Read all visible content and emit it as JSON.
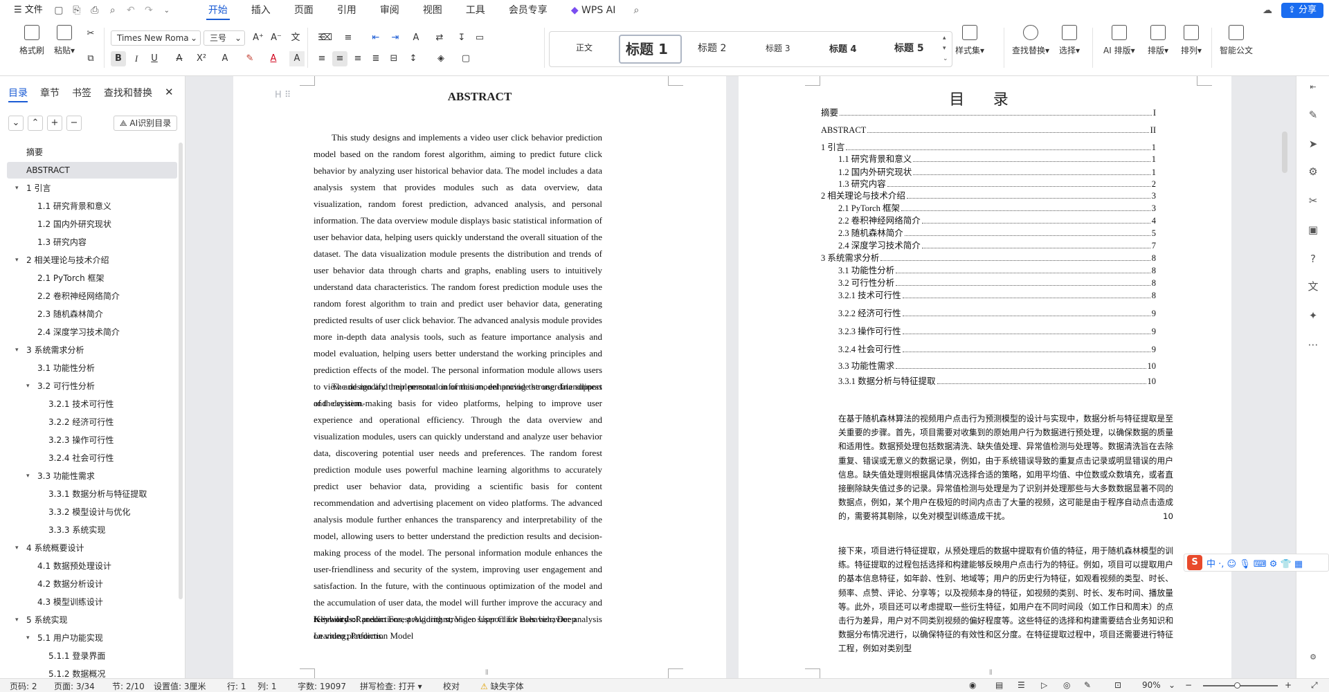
{
  "menubar": {
    "file": "文件",
    "tabs": [
      "开始",
      "插入",
      "页面",
      "引用",
      "审阅",
      "视图",
      "工具",
      "会员专享"
    ],
    "wps_ai": "WPS AI",
    "share": "分享"
  },
  "ribbon": {
    "format_painter": "格式刷",
    "paste": "粘贴",
    "font_name": "Times New Roma",
    "font_size": "三号",
    "styles": [
      "正文",
      "标题 1",
      "标题 2",
      "标题 3",
      "标题 4",
      "标题 5"
    ],
    "style_set": "样式集",
    "find_replace": "查找替换",
    "select": "选择",
    "ai_layout": "AI 排版",
    "layout": "排版",
    "arrange": "排列",
    "smart_doc": "智能公文"
  },
  "sidebar": {
    "tabs": [
      "目录",
      "章节",
      "书签",
      "查找和替换"
    ],
    "ai_toc": "AI识别目录",
    "items": [
      {
        "label": "摘要",
        "level": 1,
        "arrow": false
      },
      {
        "label": "ABSTRACT",
        "level": 1,
        "arrow": false,
        "selected": true
      },
      {
        "label": "1 引言",
        "level": 1,
        "arrow": true
      },
      {
        "label": "1.1 研究背景和意义",
        "level": 2,
        "arrow": false
      },
      {
        "label": "1.2 国内外研究现状",
        "level": 2,
        "arrow": false
      },
      {
        "label": "1.3 研究内容",
        "level": 2,
        "arrow": false
      },
      {
        "label": "2 相关理论与技术介绍",
        "level": 1,
        "arrow": true
      },
      {
        "label": "2.1 PyTorch 框架",
        "level": 2,
        "arrow": false
      },
      {
        "label": "2.2 卷积神经网络简介",
        "level": 2,
        "arrow": false
      },
      {
        "label": "2.3 随机森林简介",
        "level": 2,
        "arrow": false
      },
      {
        "label": "2.4 深度学习技术简介",
        "level": 2,
        "arrow": false
      },
      {
        "label": "3 系统需求分析",
        "level": 1,
        "arrow": true
      },
      {
        "label": "3.1 功能性分析",
        "level": 2,
        "arrow": false
      },
      {
        "label": "3.2 可行性分析",
        "level": 2,
        "arrow": true
      },
      {
        "label": "3.2.1 技术可行性",
        "level": 3,
        "arrow": false
      },
      {
        "label": "3.2.2 经济可行性",
        "level": 3,
        "arrow": false
      },
      {
        "label": "3.2.3 操作可行性",
        "level": 3,
        "arrow": false
      },
      {
        "label": "3.2.4 社会可行性",
        "level": 3,
        "arrow": false
      },
      {
        "label": "3.3 功能性需求",
        "level": 2,
        "arrow": true
      },
      {
        "label": "3.3.1 数据分析与特征提取",
        "level": 3,
        "arrow": false
      },
      {
        "label": "3.3.2 模型设计与优化",
        "level": 3,
        "arrow": false
      },
      {
        "label": "3.3.3 系统实现",
        "level": 3,
        "arrow": false
      },
      {
        "label": "4 系统概要设计",
        "level": 1,
        "arrow": true
      },
      {
        "label": "4.1 数据预处理设计",
        "level": 2,
        "arrow": false
      },
      {
        "label": "4.2 数据分析设计",
        "level": 2,
        "arrow": false
      },
      {
        "label": "4.3 模型训练设计",
        "level": 2,
        "arrow": false
      },
      {
        "label": "5 系统实现",
        "level": 1,
        "arrow": true
      },
      {
        "label": "5.1 用户功能实现",
        "level": 2,
        "arrow": true
      },
      {
        "label": "5.1.1 登录界面",
        "level": 3,
        "arrow": false
      },
      {
        "label": "5.1.2 数据概况",
        "level": 3,
        "arrow": false
      }
    ]
  },
  "page1": {
    "title": "ABSTRACT",
    "para1": "This study designs and implements a video user click behavior prediction model based on the random forest algorithm, aiming to predict future click behavior by analyzing user historical behavior data. The model includes a data analysis system that provides modules such as data overview, data visualization, random forest prediction, advanced analysis, and personal information. The data overview module displays basic statistical information of user behavior data, helping users quickly understand the overall situation of the dataset. The data visualization module presents the distribution and trends of user behavior data through charts and graphs, enabling users to intuitively understand data characteristics. The random forest prediction module uses the random forest algorithm to train and predict user behavior data, generating predicted results of user click behavior. The advanced analysis module provides more in-depth data analysis tools, such as feature importance analysis and model evaluation, helping users better understand the working principles and prediction effects of the model. The personal information module allows users to view and modify their personal information, enhancing the user-friendliness of the system.",
    "para2": "The design and implementation of this model provide strong data support and decision-making basis for video platforms, helping to improve user experience and operational efficiency. Through the data overview and visualization modules, users can quickly understand and analyze user behavior data, discovering potential user needs and preferences. The random forest prediction module uses powerful machine learning algorithms to accurately predict user behavior data, providing a scientific basis for content recommendation and advertising placement on video platforms. The advanced analysis module further enhances the transparency and interpretability of the model, allowing users to better understand the prediction results and decision-making process of the model. The personal information module enhances the user-friendliness and security of the system, improving user engagement and satisfaction. In the future, with the continuous optimization of the model and the accumulation of user data, the model will further improve the accuracy and reliability of predictions, providing stronger support for user behavior analysis on video platforms.",
    "keywords_label": "Keywords:",
    "keywords": "Random Forest Algorithm; Video User Click Behavior; Deep Learning; Prediction Model"
  },
  "page2": {
    "title": "目 录",
    "entries": [
      {
        "text": "摘要",
        "page": "I",
        "indent": 0
      },
      {
        "text": "ABSTRACT",
        "page": "II",
        "indent": 0
      },
      {
        "text": "1 引言",
        "page": "1",
        "indent": 0
      },
      {
        "text": "1.1 研究背景和意义",
        "page": "1",
        "indent": 1
      },
      {
        "text": "1.2 国内外研究现状",
        "page": "1",
        "indent": 1
      },
      {
        "text": "1.3 研究内容",
        "page": "2",
        "indent": 1
      },
      {
        "text": "2 相关理论与技术介绍",
        "page": "3",
        "indent": 0
      },
      {
        "text": "2.1 PyTorch 框架",
        "page": "3",
        "indent": 1
      },
      {
        "text": "2.2 卷积神经网络简介",
        "page": "4",
        "indent": 1
      },
      {
        "text": "2.3 随机森林简介",
        "page": "5",
        "indent": 1
      },
      {
        "text": "2.4 深度学习技术简介",
        "page": "7",
        "indent": 1
      },
      {
        "text": "3 系统需求分析",
        "page": "8",
        "indent": 0
      },
      {
        "text": "3.1 功能性分析",
        "page": "8",
        "indent": 1
      },
      {
        "text": "3.2 可行性分析",
        "page": "8",
        "indent": 1
      },
      {
        "text": "3.2.1 技术可行性",
        "page": "8",
        "indent": 1
      },
      {
        "text": "3.2.2 经济可行性",
        "page": "9",
        "indent": 1
      },
      {
        "text": "3.2.3 操作可行性",
        "page": "9",
        "indent": 1
      },
      {
        "text": "3.2.4 社会可行性",
        "page": "9",
        "indent": 1
      },
      {
        "text": "3.3 功能性需求",
        "page": "10",
        "indent": 1
      },
      {
        "text": "3.3.1 数据分析与特征提取",
        "page": "10",
        "indent": 1
      }
    ],
    "para1": "在基于随机森林算法的视频用户点击行为预测模型的设计与实现中，数据分析与特征提取是至关重要的步骤。首先，项目需要对收集到的原始用户行为数据进行预处理，以确保数据的质量和适用性。数据预处理包括数据清洗、缺失值处理、异常值检测与处理等。数据清洗旨在去除重复、错误或无意义的数据记录，例如，由于系统错误导致的重复点击记录或明显错误的用户信息。缺失值处理则根据具体情况选择合适的策略，如用平均值、中位数或众数填充，或者直接删除缺失值过多的记录。异常值检测与处理是为了识别并处理那些与大多数数据显著不同的数据点，例如，某个用户在极短的时间内点击了大量的视频，这可能是由于程序自动点击造成的，需要将其剔除，以免对模型训练造成干扰。",
    "para1_page": "10",
    "para2": "接下来，项目进行特征提取，从预处理后的数据中提取有价值的特征，用于随机森林模型的训练。特征提取的过程包括选择和构建能够反映用户点击行为的特征。例如，项目可以提取用户的基本信息特征，如年龄、性别、地域等；用户的历史行为特征，如观看视频的类型、时长、频率、点赞、评论、分享等；以及视频本身的特征，如视频的类别、时长、发布时间、播放量等。此外，项目还可以考虑提取一些衍生特征，如用户在不同时间段（如工作日和周末）的点击行为差异，用户对不同类别视频的偏好程度等。这些特征的选择和构建需要结合业务知识和数据分布情况进行，以确保特征的有效性和区分度。在特征提取过程中，项目还需要进行特征工程，例如对类别型"
  },
  "statusbar": {
    "page_no": "页码: 2",
    "pages": "页面: 3/34",
    "section": "节: 2/10",
    "setting": "设置值: 3厘米",
    "row": "行: 1",
    "col": "列: 1",
    "words": "字数: 19097",
    "spell": "拼写检查: 打开",
    "proof": "校对",
    "missing_font": "缺失字体",
    "zoom": "90%"
  }
}
